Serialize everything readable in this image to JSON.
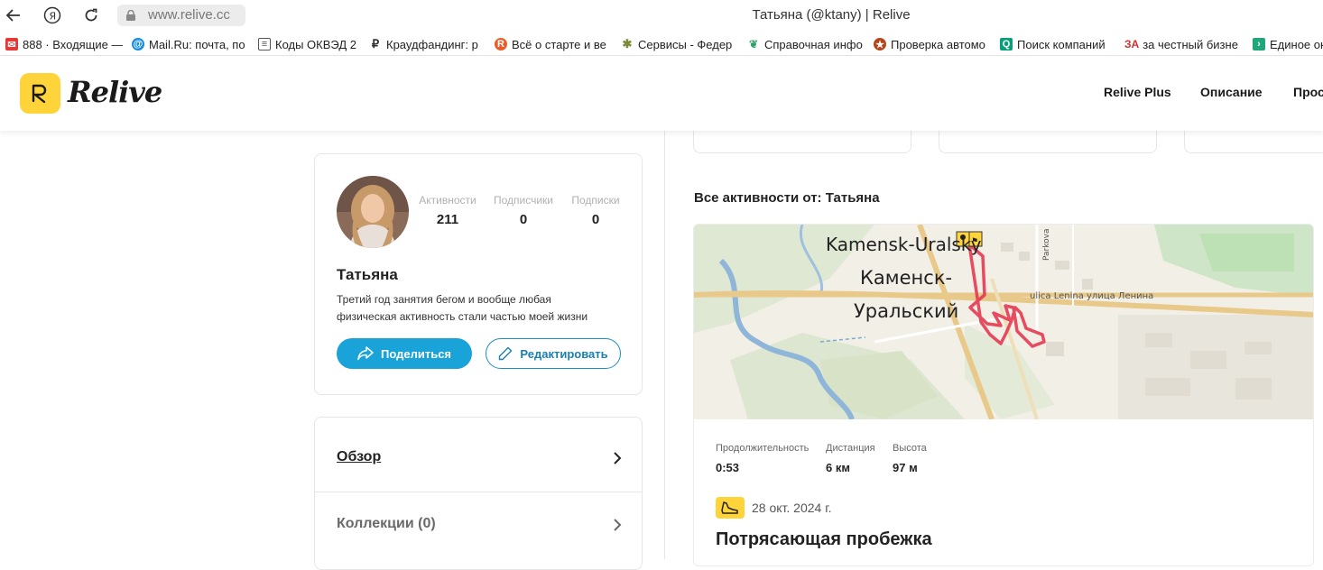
{
  "browser": {
    "url": "www.relive.cc",
    "window_title": "Татьяна (@ktany) | Relive",
    "bookmarks": [
      {
        "label": "888 · Входящие —",
        "icon": "mail-icon",
        "color": "#e53935"
      },
      {
        "label": "Mail.Ru: почта, по",
        "icon": "at-icon",
        "color": "#168de2"
      },
      {
        "label": "Коды ОКВЭД 2",
        "icon": "document-icon",
        "color": "#555555"
      },
      {
        "label": "Краудфандинг: р",
        "icon": "ruble-icon",
        "color": "#333333"
      },
      {
        "label": "Всё о старте и ве",
        "icon": "r-badge-icon",
        "color": "#e85d2a"
      },
      {
        "label": "Сервисы - Федер",
        "icon": "emblem-icon",
        "color": "#7a8b3a"
      },
      {
        "label": "Справочная инфо",
        "icon": "leaf-icon",
        "color": "#2e9e6a"
      },
      {
        "label": "Проверка автомо",
        "icon": "police-emblem-icon",
        "color": "#b5451b"
      },
      {
        "label": "Поиск компаний",
        "icon": "q-icon",
        "color": "#0a9e7a"
      },
      {
        "label": "за честный бизне",
        "icon": "za-icon",
        "color": "#d32f2f",
        "prefix": "ЗА"
      },
      {
        "label": "Единое ок",
        "icon": "green-arrow-icon",
        "color": "#1fa67a"
      }
    ]
  },
  "header": {
    "logo_text": "Relive",
    "nav": [
      "Relive Plus",
      "Описание",
      "Прос"
    ]
  },
  "profile": {
    "name": "Татьяна",
    "bio_line1": "Третий год занятия бегом и вообще любая",
    "bio_line2": "физическая активность стали частью моей жизни",
    "stats": [
      {
        "label": "Активности",
        "value": "211"
      },
      {
        "label": "Подписчики",
        "value": "0"
      },
      {
        "label": "Подписки",
        "value": "0"
      }
    ],
    "share_label": "Поделиться",
    "edit_label": "Редактировать"
  },
  "menu": [
    {
      "label": "Обзор"
    },
    {
      "label": "Коллекции (0)"
    }
  ],
  "activities": {
    "section_title": "Все активности от: Татьяна",
    "map_labels": {
      "city_en": "Kamensk-Uralsky",
      "city_ru_1": "Каменск-",
      "city_ru_2": "Уральский",
      "street": "ulica Lenina улица Ленина",
      "street2": "Parkova"
    },
    "stats": [
      {
        "label": "Продолжительность",
        "value": "0:53"
      },
      {
        "label": "Дистанция",
        "value": "6 км"
      },
      {
        "label": "Высота",
        "value": "97 м"
      }
    ],
    "date": "28 окт. 2024 г.",
    "title": "Потрясающая пробежка"
  },
  "colors": {
    "brand_yellow": "#ffd43b",
    "share_blue": "#1aa3d8",
    "route_red": "#e53950"
  }
}
